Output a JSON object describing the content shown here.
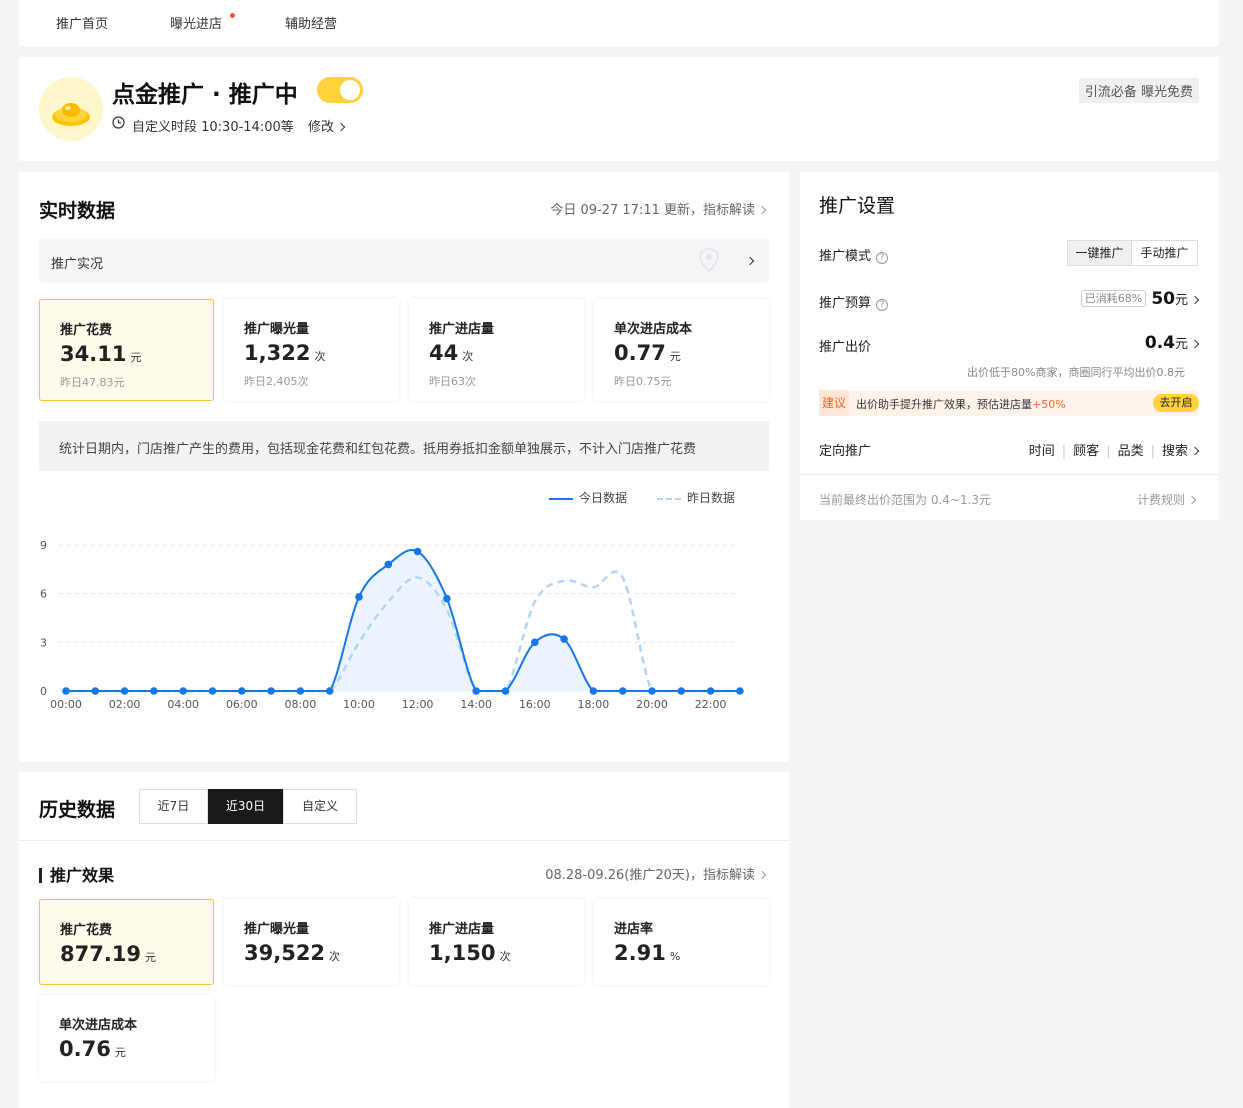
{
  "nav": {
    "items": [
      "推广首页",
      "曝光进店",
      "辅助经营"
    ]
  },
  "header": {
    "title": "点金推广 · 推广中",
    "schedule": "自定义时段 10:30-14:00等",
    "modify": "修改",
    "tag": "引流必备 曝光免费"
  },
  "realtime": {
    "title": "实时数据",
    "update": "今日 09-27 17:11 更新，指标解读",
    "live_label": "推广实况",
    "stats": [
      {
        "label": "推广花费",
        "value": "34.11",
        "unit": "元",
        "prev": "昨日47.83元"
      },
      {
        "label": "推广曝光量",
        "value": "1,322",
        "unit": "次",
        "prev": "昨日2,405次"
      },
      {
        "label": "推广进店量",
        "value": "44",
        "unit": "次",
        "prev": "昨日63次"
      },
      {
        "label": "单次进店成本",
        "value": "0.77",
        "unit": "元",
        "prev": "昨日0.75元"
      }
    ],
    "note": "统计日期内，门店推广产生的费用，包括现金花费和红包花费。抵用券抵扣金额单独展示，不计入门店推广花费"
  },
  "chart_data": {
    "type": "line",
    "x": [
      "00:00",
      "01:00",
      "02:00",
      "03:00",
      "04:00",
      "05:00",
      "06:00",
      "07:00",
      "08:00",
      "09:00",
      "10:00",
      "11:00",
      "12:00",
      "13:00",
      "14:00",
      "15:00",
      "16:00",
      "17:00",
      "18:00",
      "19:00",
      "20:00",
      "21:00",
      "22:00",
      "23:00"
    ],
    "x_ticks": [
      "00:00",
      "02:00",
      "04:00",
      "06:00",
      "08:00",
      "10:00",
      "12:00",
      "14:00",
      "16:00",
      "18:00",
      "20:00",
      "22:00"
    ],
    "y_ticks": [
      0,
      3,
      6,
      9
    ],
    "ylim": [
      0,
      9
    ],
    "series": [
      {
        "name": "今日数据",
        "style": "solid",
        "color": "#1677e5",
        "values": [
          0,
          0,
          0,
          0,
          0,
          0,
          0,
          0,
          0,
          0,
          5.8,
          7.8,
          8.6,
          5.7,
          0,
          0,
          3.0,
          3.2,
          0,
          0,
          0,
          0,
          0,
          0
        ]
      },
      {
        "name": "昨日数据",
        "style": "dashed",
        "color": "#b3d4f5",
        "values": [
          0,
          0,
          0,
          0,
          0,
          0,
          0,
          0,
          0,
          0,
          3.0,
          5.5,
          7.0,
          5.0,
          0,
          0,
          5.5,
          6.8,
          6.4,
          7.0,
          0,
          0,
          0,
          0
        ]
      }
    ]
  },
  "history": {
    "title": "历史数据",
    "tabs": [
      "近7日",
      "近30日",
      "自定义"
    ],
    "active_tab": "近30日",
    "subtitle": "推广效果",
    "range": "08.28-09.26(推广20天)，指标解读",
    "stats": [
      {
        "label": "推广花费",
        "value": "877.19",
        "unit": "元"
      },
      {
        "label": "推广曝光量",
        "value": "39,522",
        "unit": "次"
      },
      {
        "label": "推广进店量",
        "value": "1,150",
        "unit": "次"
      },
      {
        "label": "进店率",
        "value": "2.91",
        "unit": "%"
      },
      {
        "label": "单次进店成本",
        "value": "0.76",
        "unit": "元"
      }
    ]
  },
  "settings": {
    "title": "推广设置",
    "mode_label": "推广模式",
    "mode_options": [
      "一键推广",
      "手动推广"
    ],
    "budget_label": "推广预算",
    "budget_used": "已消耗68%",
    "budget_value": "50",
    "budget_unit": "元",
    "bid_label": "推广出价",
    "bid_value": "0.4",
    "bid_unit": "元",
    "bid_hint": "出价低于80%商家，商圈同行平均出价0.8元",
    "suggest_tag": "建议",
    "suggest_text": "出价助手提升推广效果，预估进店量",
    "suggest_gain": "+50%",
    "suggest_button": "去开启",
    "target_label": "定向推广",
    "target_options": [
      "时间",
      "顾客",
      "品类",
      "搜索"
    ],
    "range_note": "当前最终出价范围为 0.4~1.3元",
    "billing_rule": "计费规则"
  }
}
